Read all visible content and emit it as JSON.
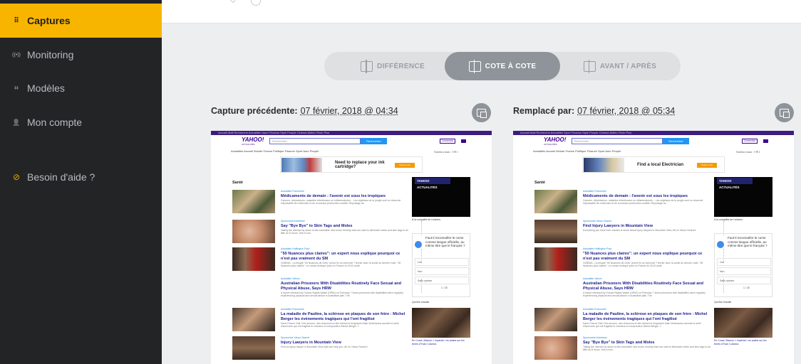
{
  "sidebar": {
    "items": [
      {
        "label": "Captures",
        "icon": "grid-icon",
        "glyph": "⠿"
      },
      {
        "label": "Monitoring",
        "icon": "signal-icon",
        "glyph": "((•))"
      },
      {
        "label": "Modèles",
        "icon": "crop-icon",
        "glyph": "⌗"
      },
      {
        "label": "Mon compte",
        "icon": "user-icon",
        "glyph": "👤"
      },
      {
        "label": "Besoin d'aide ?",
        "icon": "help-icon",
        "glyph": "⊘"
      }
    ]
  },
  "view_switcher": {
    "options": [
      "DIFFÉRENCE",
      "COTE À COTE",
      "AVANT / APRÈS"
    ],
    "selected": "COTE À COTE"
  },
  "left_capture": {
    "label": "Capture précédente:",
    "date": "07 février, 2018 @ 04:34"
  },
  "right_capture": {
    "label": "Remplacé par:",
    "date": "07 février, 2018 @ 05:34"
  },
  "colors": {
    "accent": "#f8b500",
    "sidebar_bg": "#222426",
    "segment_active": "#8e9499",
    "yahoo_purple": "#400090"
  },
  "left_page": {
    "topbar": "Accueil   Mail   Recherche   Actualités   Sport   Finance   Style   People   Cinéma   Météo   Flickr   Plus",
    "logo": "YAHOO!",
    "logo_sub": "ACTUALITÉS",
    "search_placeholder": "Rechercher",
    "search_button": "Rechercher",
    "login": "Connexion",
    "nav": "Actualités Accueil   Monde   France   Politique   Finance   Sport   Auto   People",
    "social": "Suivez-nous :  f  ✉  t",
    "ad_text": "Need to replace your ink cartridge?",
    "ad_button": "Search now",
    "section": "Santé",
    "articles": [
      {
        "src": "Actualités   Franceinfo",
        "title": "Médicaments de demain : l'avenir est sous les tropiques",
        "desc": "Cancers, dépressions, maladies infectieuses ou inflammatoires... Les végétaux de la jungle sont un réservoir inépuisable de molécules et de nouveaux protocoles curatifs. Reportage au"
      },
      {
        "src": "Sponsorisé   Advertiser",
        "title": "Say \"Bye Bye\" to Skin Tags and Moles",
        "desc": "Taking the internet by storm is this incredible new home remedy that can start to eliminate moles and skin tags in as little as 8 hours. See it now."
      },
      {
        "src": "Actualités   Huffington Post",
        "title": "\"50 Nuances plus claires\": un expert nous explique pourquoi ce n'est pas vraiment du SM",
        "desc": "CINÉMA - La trilogie \"50 Nuances de Grey\" prend fin ce mercredi 7 février avec la sortie du dernier volet, \"50 Nuances plus claires\". Le roman érotique paru en France en 2012 avait"
      },
      {
        "src": "Actualités   Yahoo!",
        "title": "Australian Prisoners With Disabilities Routinely Face Sexual and Physical Abuse, Says HRW",
        "desc": "A report released by Human Rights Watch (HRW) on February 7 found prisoners with disabilities were regularly experiencing physical and sexual abuse in Australian jails. The"
      },
      {
        "src": "Actualités   Franceinfo",
        "title": "La maladie de Pauline, la sclérose en plaques de son frère : Michel Berger les événements tragiques qui l'ont fragilisé",
        "desc": "Dans France Gall, Des amours, des chansons et des larmes le biographe Alain Wodrascka raconte la série d'épreuves qui ont fragilisé le chanteur et compositeur Michel Berger. »"
      },
      {
        "src": "Sponsorisé   Yahoo Search",
        "title": "Injury Lawyers in Mountain View",
        "desc": "Find an injury lawyer in Mountain View that can help you. All on Yahoo Search!"
      }
    ],
    "video_logo": "YAHOO! ACTUALITÉS",
    "video_caption": "À la conquête de l'univers",
    "poll_question": "Faut-il reconnaître le corse comme langue officielle, au même titre que le français ?",
    "poll_options": [
      "Oui",
      "Non",
      "Sans opinion"
    ],
    "poll_pager": "1 / 25",
    "rail_title": "Qui fine ensuite",
    "rail_caption": "En Corse, Macron « impérial » en plaine sur les terres d'Yvan Colonna"
  },
  "right_page": {
    "topbar": "Accueil   Mail   Recherche   Actualités   Sport   Finance   Style   People   Cinéma   Météo   Flickr   Plus",
    "logo": "YAHOO!",
    "logo_sub": "ACTUALITÉS",
    "search_placeholder": "Rechercher",
    "search_button": "Rechercher",
    "login": "Connexion",
    "nav": "Actualités Accueil   Monde   France   Politique   Finance   Sport   Auto   People",
    "social": "Suivez-nous :  f  ✉  t",
    "ad_text": "Find a local Electrician",
    "ad_button": "Search now",
    "section": "Santé",
    "articles": [
      {
        "src": "Actualités   Franceinfo",
        "title": "Médicaments de demain : l'avenir est sous les tropiques",
        "desc": "Cancers, dépressions, maladies infectieuses ou inflammatoires... Les végétaux de la jungle sont un réservoir inépuisable de molécules et de nouveaux protocoles curatifs. Reportage au"
      },
      {
        "src": "Sponsorisé   Yahoo Search",
        "title": "Find Injury Lawyers in Mountain View",
        "desc": "Everything you have ever wanted to know about injury lawyers in Mountain View. All on Yahoo Search!"
      },
      {
        "src": "Actualités   Huffington Post",
        "title": "\"50 Nuances plus claires\": un expert nous explique pourquoi ce n'est pas vraiment du SM",
        "desc": "CINÉMA - La trilogie \"50 Nuances de Grey\" prend fin ce mercredi 7 février avec la sortie du dernier volet, \"50 Nuances plus claires\". Le roman érotique paru en France en 2012 avait"
      },
      {
        "src": "Actualités   Yahoo!",
        "title": "Australian Prisoners With Disabilities Routinely Face Sexual and Physical Abuse, Says HRW",
        "desc": "A report released by Human Rights Watch (HRW) on February 7 found prisoners with disabilities were regularly experiencing physical and sexual abuse in Australian jails. The"
      },
      {
        "src": "Actualités   Franceinfo",
        "title": "La maladie de Pauline, la sclérose en plaques de son frère : Michel Berger les événements tragiques qui l'ont fragilisé",
        "desc": "Dans France Gall, Des amours, des chansons et des larmes le biographe Alain Wodrascka raconte la série d'épreuves qui ont fragilisé le chanteur et compositeur Michel Berger. »"
      },
      {
        "src": "Sponsorisé   Advertiser",
        "title": "Say \"Bye Bye\" to Skin Tags and Moles",
        "desc": "Taking the internet by storm is this incredible new home remedy that can start to eliminate moles and skin tags in as little as 8 hours. See it now."
      }
    ],
    "video_logo": "YAHOO! ACTUALITÉS",
    "video_caption": "À la conquête de l'univers",
    "poll_question": "Faut-il reconnaître le corse comme langue officielle, au même titre que le français ?",
    "poll_options": [
      "Oui",
      "Non",
      "Sans opinion"
    ],
    "poll_pager": "1 / 25",
    "rail_title": "Qui fine ensuite",
    "rail_caption": "En Corse, Macron « impérial » en plaine sur les terres d'Yvan Colonna"
  }
}
